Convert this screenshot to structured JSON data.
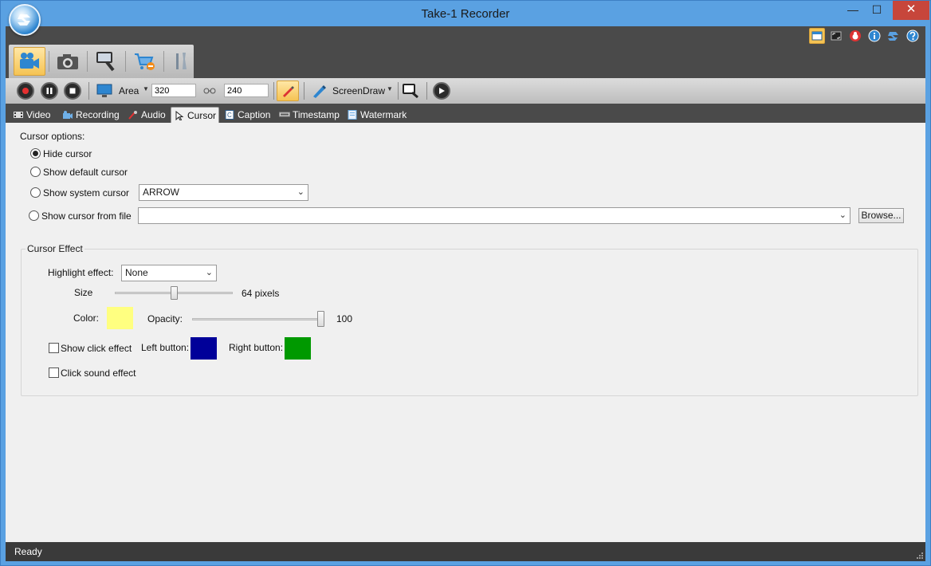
{
  "window": {
    "title": "Take-1 Recorder",
    "controls": {
      "minimize": "—",
      "maximize": "☐",
      "close": "✕"
    }
  },
  "modes": [
    {
      "name": "video-camera-icon",
      "active": true
    },
    {
      "name": "photo-camera-icon",
      "active": false
    },
    {
      "name": "screen-capture-icon",
      "active": false
    },
    {
      "name": "cart-icon",
      "active": false
    },
    {
      "name": "tools-icon",
      "active": false
    }
  ],
  "top_right_icons": [
    "window-icon",
    "fullscreen-icon",
    "bug-icon",
    "info-icon",
    "logo-icon",
    "help-icon"
  ],
  "toolbar": {
    "area_label": "Area",
    "width_value": "320",
    "height_value": "240",
    "screendraw_label": "ScreenDraw"
  },
  "tabs": [
    {
      "label": "Video",
      "icon": "film-icon"
    },
    {
      "label": "Recording",
      "icon": "recording-icon"
    },
    {
      "label": "Audio",
      "icon": "audio-icon"
    },
    {
      "label": "Cursor",
      "icon": "cursor-icon",
      "active": true
    },
    {
      "label": "Caption",
      "icon": "caption-icon"
    },
    {
      "label": "Timestamp",
      "icon": "timestamp-icon"
    },
    {
      "label": "Watermark",
      "icon": "watermark-icon"
    }
  ],
  "cursor_options": {
    "heading": "Cursor options:",
    "hide": "Hide cursor",
    "show_default": "Show default cursor",
    "show_system": "Show system cursor",
    "system_cursor_value": "ARROW",
    "show_from_file": "Show cursor from file",
    "file_value": "",
    "browse_label": "Browse...",
    "selected": "hide"
  },
  "cursor_effect": {
    "title": "Cursor Effect",
    "highlight_label": "Highlight effect:",
    "highlight_value": "None",
    "size_label": "Size",
    "size_value": "64 pixels",
    "size_level": 0.5,
    "color_label": "Color:",
    "color_hex": "#ffff80",
    "opacity_label": "Opacity:",
    "opacity_value": "100",
    "opacity_level": 1.0,
    "show_click_label": "Show click effect",
    "show_click_checked": false,
    "left_button_label": "Left button:",
    "left_button_color": "#000099",
    "right_button_label": "Right button:",
    "right_button_color": "#009900",
    "click_sound_label": "Click sound effect",
    "click_sound_checked": false
  },
  "status": {
    "text": "Ready"
  },
  "colors": {
    "titlebar": "#5aa1e2",
    "dark_panel": "#4a4a4a",
    "active_highlight": "#f5c353"
  }
}
